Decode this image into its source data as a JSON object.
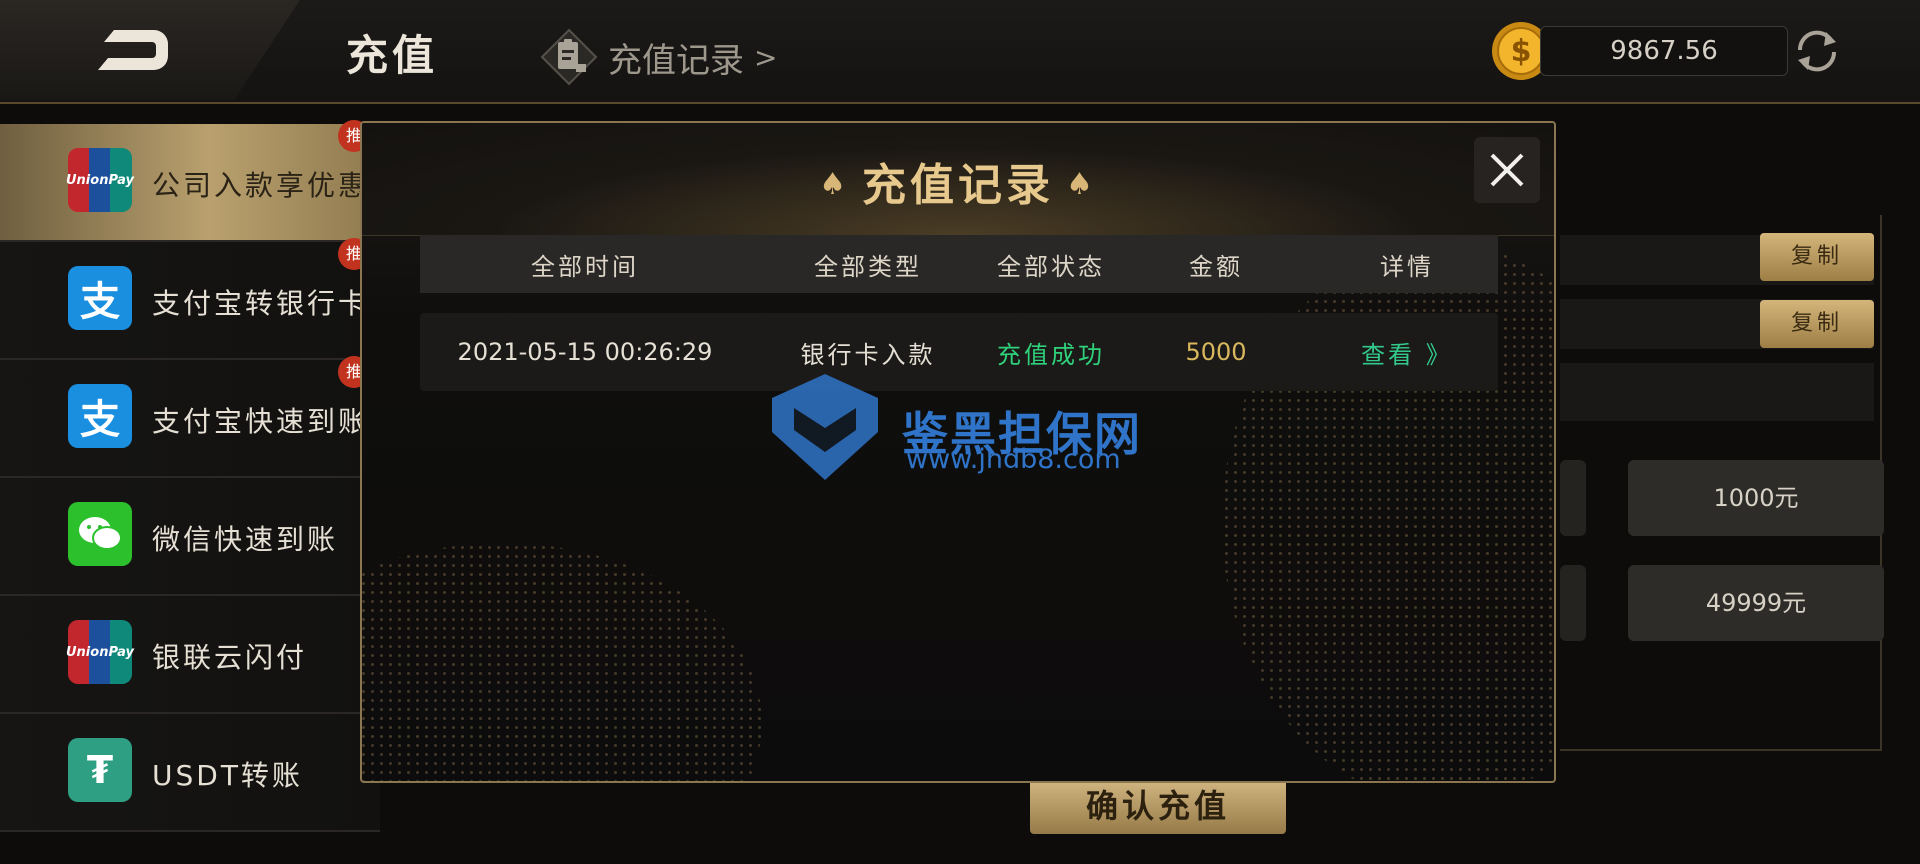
{
  "header": {
    "title": "充值",
    "record_link": "充值记录",
    "record_chevron": ">",
    "balance": "9867.56"
  },
  "sidebar": {
    "items": [
      {
        "label": "公司入款享优惠",
        "icon": "unionpay-icon",
        "badge": "推",
        "active": true
      },
      {
        "label": "支付宝转银行卡",
        "icon": "alipay-icon",
        "badge": "推",
        "active": false
      },
      {
        "label": "支付宝快速到账",
        "icon": "alipay-icon",
        "badge": "推",
        "active": false
      },
      {
        "label": "微信快速到账",
        "icon": "wechat-icon",
        "badge": "",
        "active": false
      },
      {
        "label": "银联云闪付",
        "icon": "unionpay-icon",
        "badge": "",
        "active": false
      },
      {
        "label": "USDT转账",
        "icon": "tether-icon",
        "badge": "",
        "active": false
      }
    ]
  },
  "background_panel": {
    "copy_button": "复制",
    "amount_buttons": [
      "1000元",
      "49999元"
    ],
    "confirm_button": "确认充值"
  },
  "modal": {
    "title": "充值记录",
    "columns": [
      "全部时间",
      "全部类型",
      "全部状态",
      "金额",
      "详情"
    ],
    "rows": [
      {
        "time": "2021-05-15 00:26:29",
        "type": "银行卡入款",
        "status": "充值成功",
        "amount": "5000",
        "detail": "查看 》"
      }
    ]
  },
  "watermark": {
    "text": "鉴黑担保网",
    "url": "www.jhdb8.com"
  },
  "colors": {
    "gold_accent": "#e7c98d",
    "status_success": "#2fd17a",
    "amount": "#d9b75d",
    "frame": "#8a7650"
  }
}
